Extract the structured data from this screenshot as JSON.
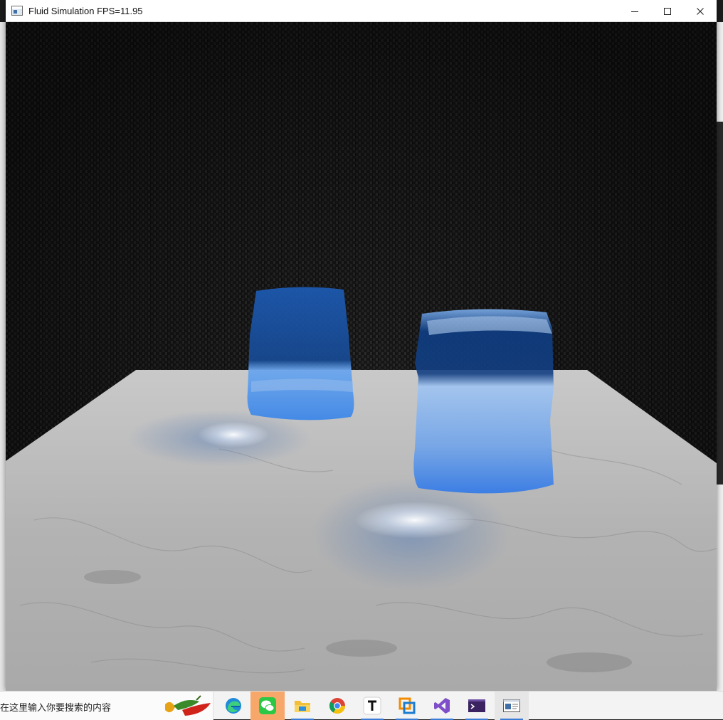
{
  "window": {
    "title": "Fluid Simulation FPS=11.95"
  },
  "search": {
    "placeholder": "在这里输入你要搜索的内容"
  },
  "taskbar": {
    "items": [
      {
        "name": "edge",
        "icon": "edge-icon"
      },
      {
        "name": "wechat",
        "icon": "wechat-icon",
        "active": true
      },
      {
        "name": "file-explorer",
        "icon": "folder-icon"
      },
      {
        "name": "chrome",
        "icon": "chrome-icon"
      },
      {
        "name": "typora",
        "icon": "typora-icon"
      },
      {
        "name": "vmware",
        "icon": "vmware-icon"
      },
      {
        "name": "visual-studio",
        "icon": "visual-studio-icon"
      },
      {
        "name": "terminal",
        "icon": "terminal-icon"
      },
      {
        "name": "fluid-simulation-app",
        "icon": "app-window-icon"
      }
    ]
  },
  "colors": {
    "water": "#2f78e8",
    "water_dark": "#0f3e84",
    "marble": "#b9b9b9",
    "backdrop": "#1b1b1b",
    "active_task": "#f7a769",
    "task_underline": "#3a7bd5"
  }
}
